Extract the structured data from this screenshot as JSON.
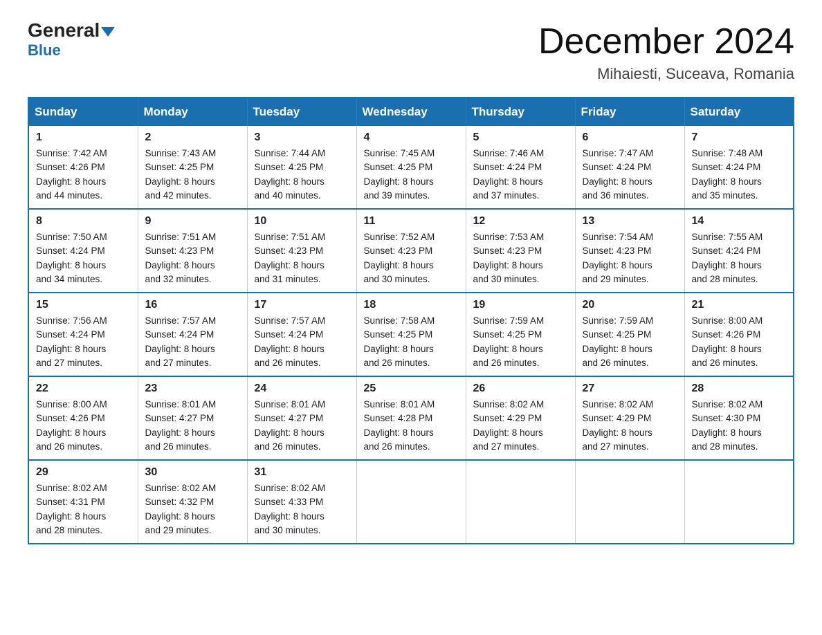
{
  "logo": {
    "general": "General",
    "blue": "Blue"
  },
  "title": "December 2024",
  "subtitle": "Mihaiesti, Suceava, Romania",
  "days_of_week": [
    "Sunday",
    "Monday",
    "Tuesday",
    "Wednesday",
    "Thursday",
    "Friday",
    "Saturday"
  ],
  "weeks": [
    [
      {
        "day": "1",
        "sunrise": "7:42 AM",
        "sunset": "4:26 PM",
        "daylight": "8 hours and 44 minutes."
      },
      {
        "day": "2",
        "sunrise": "7:43 AM",
        "sunset": "4:25 PM",
        "daylight": "8 hours and 42 minutes."
      },
      {
        "day": "3",
        "sunrise": "7:44 AM",
        "sunset": "4:25 PM",
        "daylight": "8 hours and 40 minutes."
      },
      {
        "day": "4",
        "sunrise": "7:45 AM",
        "sunset": "4:25 PM",
        "daylight": "8 hours and 39 minutes."
      },
      {
        "day": "5",
        "sunrise": "7:46 AM",
        "sunset": "4:24 PM",
        "daylight": "8 hours and 37 minutes."
      },
      {
        "day": "6",
        "sunrise": "7:47 AM",
        "sunset": "4:24 PM",
        "daylight": "8 hours and 36 minutes."
      },
      {
        "day": "7",
        "sunrise": "7:48 AM",
        "sunset": "4:24 PM",
        "daylight": "8 hours and 35 minutes."
      }
    ],
    [
      {
        "day": "8",
        "sunrise": "7:50 AM",
        "sunset": "4:24 PM",
        "daylight": "8 hours and 34 minutes."
      },
      {
        "day": "9",
        "sunrise": "7:51 AM",
        "sunset": "4:23 PM",
        "daylight": "8 hours and 32 minutes."
      },
      {
        "day": "10",
        "sunrise": "7:51 AM",
        "sunset": "4:23 PM",
        "daylight": "8 hours and 31 minutes."
      },
      {
        "day": "11",
        "sunrise": "7:52 AM",
        "sunset": "4:23 PM",
        "daylight": "8 hours and 30 minutes."
      },
      {
        "day": "12",
        "sunrise": "7:53 AM",
        "sunset": "4:23 PM",
        "daylight": "8 hours and 30 minutes."
      },
      {
        "day": "13",
        "sunrise": "7:54 AM",
        "sunset": "4:23 PM",
        "daylight": "8 hours and 29 minutes."
      },
      {
        "day": "14",
        "sunrise": "7:55 AM",
        "sunset": "4:24 PM",
        "daylight": "8 hours and 28 minutes."
      }
    ],
    [
      {
        "day": "15",
        "sunrise": "7:56 AM",
        "sunset": "4:24 PM",
        "daylight": "8 hours and 27 minutes."
      },
      {
        "day": "16",
        "sunrise": "7:57 AM",
        "sunset": "4:24 PM",
        "daylight": "8 hours and 27 minutes."
      },
      {
        "day": "17",
        "sunrise": "7:57 AM",
        "sunset": "4:24 PM",
        "daylight": "8 hours and 26 minutes."
      },
      {
        "day": "18",
        "sunrise": "7:58 AM",
        "sunset": "4:25 PM",
        "daylight": "8 hours and 26 minutes."
      },
      {
        "day": "19",
        "sunrise": "7:59 AM",
        "sunset": "4:25 PM",
        "daylight": "8 hours and 26 minutes."
      },
      {
        "day": "20",
        "sunrise": "7:59 AM",
        "sunset": "4:25 PM",
        "daylight": "8 hours and 26 minutes."
      },
      {
        "day": "21",
        "sunrise": "8:00 AM",
        "sunset": "4:26 PM",
        "daylight": "8 hours and 26 minutes."
      }
    ],
    [
      {
        "day": "22",
        "sunrise": "8:00 AM",
        "sunset": "4:26 PM",
        "daylight": "8 hours and 26 minutes."
      },
      {
        "day": "23",
        "sunrise": "8:01 AM",
        "sunset": "4:27 PM",
        "daylight": "8 hours and 26 minutes."
      },
      {
        "day": "24",
        "sunrise": "8:01 AM",
        "sunset": "4:27 PM",
        "daylight": "8 hours and 26 minutes."
      },
      {
        "day": "25",
        "sunrise": "8:01 AM",
        "sunset": "4:28 PM",
        "daylight": "8 hours and 26 minutes."
      },
      {
        "day": "26",
        "sunrise": "8:02 AM",
        "sunset": "4:29 PM",
        "daylight": "8 hours and 27 minutes."
      },
      {
        "day": "27",
        "sunrise": "8:02 AM",
        "sunset": "4:29 PM",
        "daylight": "8 hours and 27 minutes."
      },
      {
        "day": "28",
        "sunrise": "8:02 AM",
        "sunset": "4:30 PM",
        "daylight": "8 hours and 28 minutes."
      }
    ],
    [
      {
        "day": "29",
        "sunrise": "8:02 AM",
        "sunset": "4:31 PM",
        "daylight": "8 hours and 28 minutes."
      },
      {
        "day": "30",
        "sunrise": "8:02 AM",
        "sunset": "4:32 PM",
        "daylight": "8 hours and 29 minutes."
      },
      {
        "day": "31",
        "sunrise": "8:02 AM",
        "sunset": "4:33 PM",
        "daylight": "8 hours and 30 minutes."
      },
      null,
      null,
      null,
      null
    ]
  ],
  "labels": {
    "sunrise": "Sunrise:",
    "sunset": "Sunset:",
    "daylight": "Daylight:"
  }
}
